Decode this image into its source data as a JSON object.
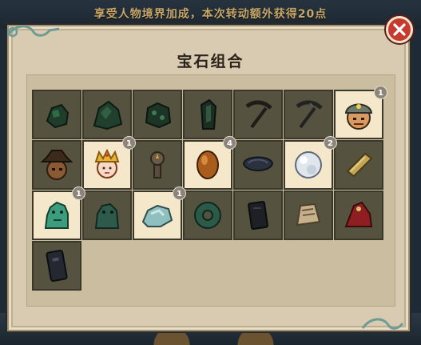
{
  "background": {
    "banner_text": "享受人物境界加成，本次转动额外获得20点"
  },
  "dialog": {
    "title": "宝石组合"
  },
  "colors": {
    "panel": "#d8cbb2",
    "slot_dark": "#55533f",
    "slot_owned": "#f5e7c9",
    "close": "#c63b30",
    "badge": "#8c8379"
  },
  "items": [
    {
      "icon": "dark-green-ore-icon",
      "owned": false,
      "count": ""
    },
    {
      "icon": "dark-green-rock-icon",
      "owned": false,
      "count": ""
    },
    {
      "icon": "green-ore-chunk-icon",
      "owned": false,
      "count": ""
    },
    {
      "icon": "dark-crystal-shard-icon",
      "owned": false,
      "count": ""
    },
    {
      "icon": "pickaxe-icon",
      "owned": false,
      "count": ""
    },
    {
      "icon": "pickaxe-dark-icon",
      "owned": false,
      "count": ""
    },
    {
      "icon": "miner-helmet-face-icon",
      "owned": true,
      "count": "1"
    },
    {
      "icon": "explorer-hat-face-icon",
      "owned": false,
      "count": ""
    },
    {
      "icon": "crowned-princess-icon",
      "owned": true,
      "count": "1"
    },
    {
      "icon": "candle-lamp-icon",
      "owned": false,
      "count": ""
    },
    {
      "icon": "amber-gem-icon",
      "owned": true,
      "count": "4"
    },
    {
      "icon": "dark-bowl-icon",
      "owned": false,
      "count": ""
    },
    {
      "icon": "pearl-orb-icon",
      "owned": true,
      "count": "2"
    },
    {
      "icon": "gold-bar-icon",
      "owned": false,
      "count": ""
    },
    {
      "icon": "jade-lion-icon",
      "owned": true,
      "count": "1"
    },
    {
      "icon": "jade-beast-icon",
      "owned": false,
      "count": ""
    },
    {
      "icon": "jade-rock-icon",
      "owned": true,
      "count": "1"
    },
    {
      "icon": "jade-disc-icon",
      "owned": false,
      "count": ""
    },
    {
      "icon": "black-tablet-icon",
      "owned": false,
      "count": ""
    },
    {
      "icon": "scroll-paper-icon",
      "owned": false,
      "count": ""
    },
    {
      "icon": "red-cloth-icon",
      "owned": false,
      "count": ""
    },
    {
      "icon": "dark-plaque-icon",
      "owned": false,
      "count": ""
    }
  ]
}
